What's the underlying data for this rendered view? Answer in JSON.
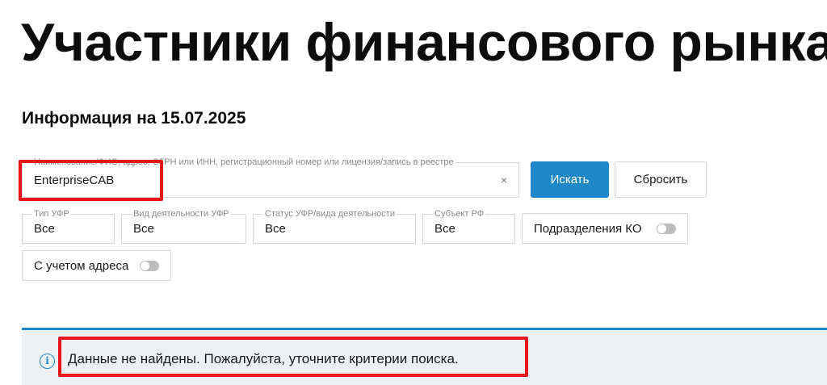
{
  "page": {
    "title": "Участники финансового рынка",
    "info_date": "Информация на 15.07.2025"
  },
  "search": {
    "legend": "Наименование/ФИО, адрес, ОГРН или ИНН, регистрационный номер или лицензия/запись в реестре",
    "value": "EnterpriseCAB",
    "clear_icon": "×",
    "search_button": "Искать",
    "reset_button": "Сбросить"
  },
  "filters": {
    "type": {
      "legend": "Тип УФР",
      "value": "Все"
    },
    "activity": {
      "legend": "Вид деятельности УФР",
      "value": "Все"
    },
    "status": {
      "legend": "Статус УФР/вида деятельности",
      "value": "Все"
    },
    "region": {
      "legend": "Субъект РФ",
      "value": "Все"
    }
  },
  "toggles": {
    "ko_divisions": {
      "label": "Подразделения КО",
      "on": false
    },
    "with_address": {
      "label": "С учетом адреса",
      "on": false
    }
  },
  "notice": {
    "icon": "info-icon",
    "icon_glyph": "i",
    "text": "Данные не найдены. Пожалуйста, уточните критерии поиска."
  },
  "colors": {
    "accent": "#1e88c9",
    "highlight": "#e8141c"
  }
}
